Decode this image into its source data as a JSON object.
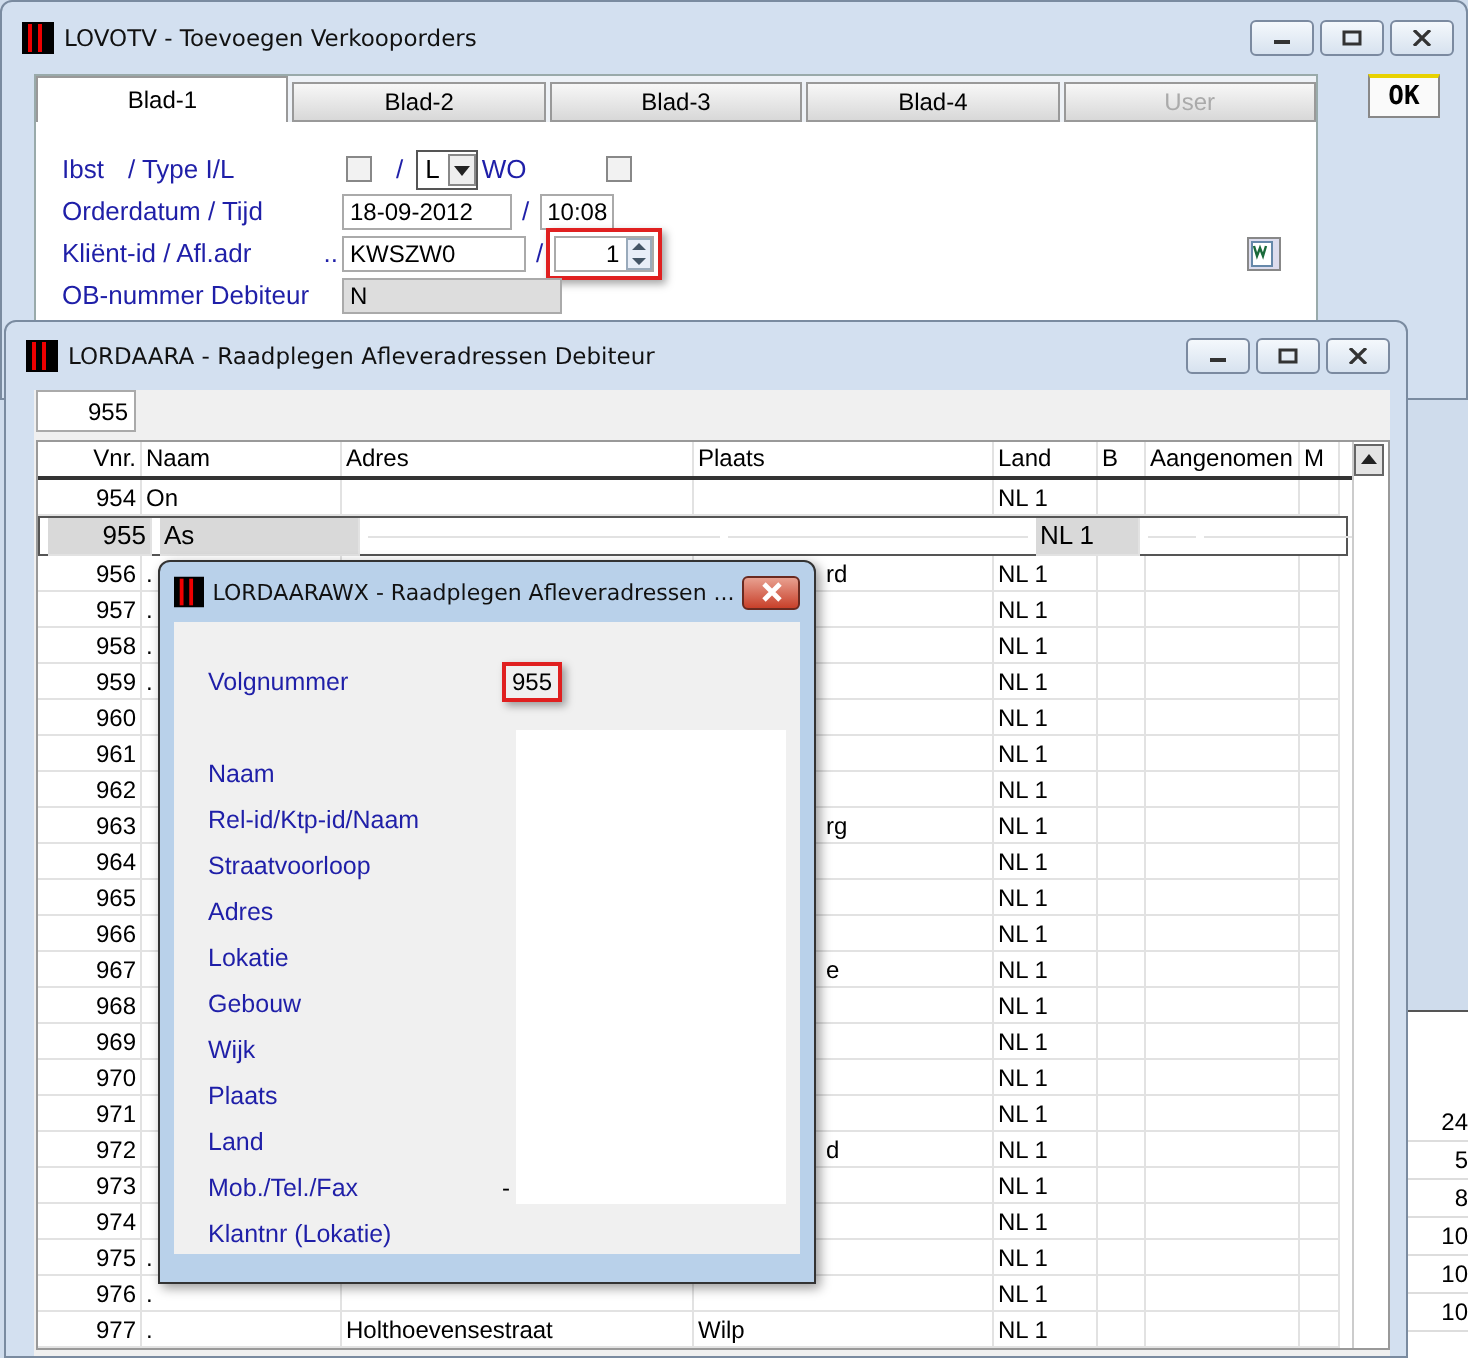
{
  "main_window": {
    "title": "LOVOTV - Toevoegen Verkooporders",
    "tabs": [
      {
        "label": "Blad-1",
        "selected": true,
        "disabled": false
      },
      {
        "label": "Blad-2",
        "selected": false,
        "disabled": false
      },
      {
        "label": "Blad-3",
        "selected": false,
        "disabled": false
      },
      {
        "label": "Blad-4",
        "selected": false,
        "disabled": false
      },
      {
        "label": "User",
        "selected": false,
        "disabled": true
      }
    ],
    "ok_button": "OK",
    "form": {
      "ibst_label": "Ibst",
      "type_label": "/ Type I/L",
      "ibst_checked": false,
      "type_separator": "/",
      "type_value": "L",
      "wo_label": "WO",
      "wo_checked": false,
      "orderdatum_label": "Orderdatum / Tijd",
      "orderdatum": "18-09-2012",
      "tijd_separator": "/",
      "tijd": "10:08",
      "klient_label": "Kliënt-id / Afl.adr",
      "klient_dots": "..",
      "klient_id": "KWSZW0",
      "afl_separator": "/",
      "afl_adr": "1",
      "afl_adr_highlighted": true,
      "ob_label": "OB-nummer Debiteur",
      "ob_value": "N"
    }
  },
  "list_window": {
    "title": "LORDAARA - Raadplegen Afleveradressen Debiteur",
    "search_value": "955",
    "columns": [
      "Vnr.",
      "Naam",
      "Adres",
      "Plaats",
      "Land",
      "B",
      "Aangenomen",
      "M"
    ],
    "rows": [
      {
        "vnr": "954",
        "naam": "On",
        "land": "NL 1",
        "selected": false
      },
      {
        "vnr": "955",
        "naam": "As",
        "land": "NL 1",
        "selected": true
      },
      {
        "vnr": "956",
        "naam": ".",
        "plaats": "rd",
        "land": "NL 1",
        "selected": false
      },
      {
        "vnr": "957",
        "naam": ".",
        "land": "NL 1",
        "selected": false
      },
      {
        "vnr": "958",
        "naam": ".",
        "land": "NL 1",
        "selected": false
      },
      {
        "vnr": "959",
        "naam": ".",
        "land": "NL 1",
        "selected": false
      },
      {
        "vnr": "960",
        "land": "NL 1",
        "selected": false
      },
      {
        "vnr": "961",
        "land": "NL 1",
        "selected": false
      },
      {
        "vnr": "962",
        "land": "NL 1",
        "selected": false
      },
      {
        "vnr": "963",
        "plaats": "rg",
        "land": "NL 1",
        "selected": false
      },
      {
        "vnr": "964",
        "land": "NL 1",
        "selected": false
      },
      {
        "vnr": "965",
        "land": "NL 1",
        "selected": false
      },
      {
        "vnr": "966",
        "land": "NL 1",
        "selected": false
      },
      {
        "vnr": "967",
        "plaats": "e",
        "land": "NL 1",
        "selected": false
      },
      {
        "vnr": "968",
        "land": "NL 1",
        "selected": false
      },
      {
        "vnr": "969",
        "land": "NL 1",
        "selected": false
      },
      {
        "vnr": "970",
        "land": "NL 1",
        "selected": false
      },
      {
        "vnr": "971",
        "land": "NL 1",
        "selected": false
      },
      {
        "vnr": "972",
        "plaats": "d",
        "land": "NL 1",
        "selected": false
      },
      {
        "vnr": "973",
        "land": "NL 1",
        "selected": false
      },
      {
        "vnr": "974",
        "land": "NL 1",
        "selected": false
      },
      {
        "vnr": "975",
        "naam": ".",
        "land": "NL 1",
        "selected": false
      },
      {
        "vnr": "976",
        "naam": ".",
        "land": "NL 1",
        "selected": false
      },
      {
        "vnr": "977",
        "naam": ".",
        "adres": "Holthoevensestraat",
        "plaats": "Wilp",
        "land": "NL 1",
        "selected": false
      }
    ]
  },
  "side_column": [
    "24",
    "5",
    "8",
    "10",
    "10",
    "10"
  ],
  "dialog": {
    "title": "LORDAARAWX - Raadplegen Afleveradressen ...",
    "volgnummer_label": "Volgnummer",
    "volgnummer": "955",
    "volgnummer_highlighted": true,
    "fields": [
      {
        "label": "Naam"
      },
      {
        "label": "Rel-id/Ktp-id/Naam"
      },
      {
        "label": "Straatvoorloop"
      },
      {
        "label": "Adres"
      },
      {
        "label": "Lokatie"
      },
      {
        "label": "Gebouw"
      },
      {
        "label": "Wijk"
      },
      {
        "label": "Plaats"
      },
      {
        "label": "Land"
      },
      {
        "label": "Mob./Tel./Fax",
        "value": "-"
      },
      {
        "label": "Klantnr (Lokatie)"
      }
    ]
  }
}
